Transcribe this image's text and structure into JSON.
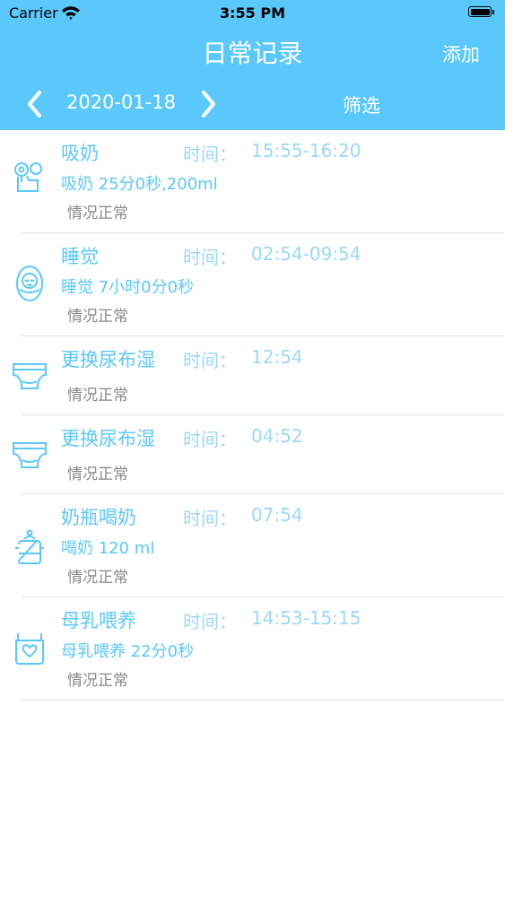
{
  "status_bar": {
    "carrier": "Carrier",
    "time": "3:55 PM"
  },
  "nav": {
    "title": "日常记录",
    "add_label": "添加",
    "date": "2020-01-18",
    "filter_label": "筛选"
  },
  "colors": {
    "accent": "#5ac8fa",
    "time_text": "#9bd8f7",
    "status_text": "#888888"
  },
  "records": [
    {
      "icon": "breast-pump-icon",
      "title": "吸奶",
      "time_label": "时间：",
      "time": "15:55-16:20",
      "detail": "吸奶 25分0秒,200ml",
      "status": "情况正常"
    },
    {
      "icon": "sleeping-baby-icon",
      "title": "睡觉",
      "time_label": "时间：",
      "time": "02:54-09:54",
      "detail": "睡觉 7小时0分0秒",
      "status": "情况正常"
    },
    {
      "icon": "diaper-icon",
      "title": "更换尿布湿",
      "time_label": "时间：",
      "time": "12:54",
      "detail": "",
      "status": "情况正常"
    },
    {
      "icon": "diaper-icon",
      "title": "更换尿布湿",
      "time_label": "时间：",
      "time": "04:52",
      "detail": "",
      "status": "情况正常"
    },
    {
      "icon": "bottle-icon",
      "title": "奶瓶喝奶",
      "time_label": "时间：",
      "time": "07:54",
      "detail": "喝奶 120 ml",
      "status": "情况正常"
    },
    {
      "icon": "breastfeeding-icon",
      "title": "母乳喂养",
      "time_label": "时间：",
      "time": "14:53-15:15",
      "detail": "母乳喂养 22分0秒",
      "status": "情况正常"
    }
  ]
}
